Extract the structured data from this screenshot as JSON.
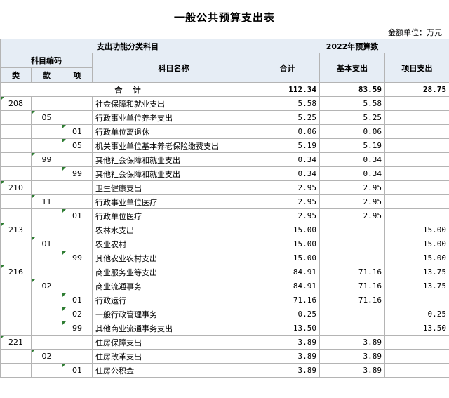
{
  "title": "一般公共预算支出表",
  "unit": "金额单位：万元",
  "headers": {
    "category_group": "支出功能分类科目",
    "budget_group": "2022年预算数",
    "code": "科目编码",
    "lei": "类",
    "kuan": "款",
    "xiang": "项",
    "name": "科目名称",
    "total": "合计",
    "basic": "基本支出",
    "project": "项目支出"
  },
  "total_row": {
    "label": "合    计",
    "total": "112.34",
    "basic": "83.59",
    "project": "28.75"
  },
  "rows": [
    {
      "lei": "208",
      "kuan": "",
      "xiang": "",
      "name": "社会保障和就业支出",
      "total": "5.58",
      "basic": "5.58",
      "project": ""
    },
    {
      "lei": "",
      "kuan": "05",
      "xiang": "",
      "name": "行政事业单位养老支出",
      "total": "5.25",
      "basic": "5.25",
      "project": ""
    },
    {
      "lei": "",
      "kuan": "",
      "xiang": "01",
      "name": "行政单位离退休",
      "total": "0.06",
      "basic": "0.06",
      "project": ""
    },
    {
      "lei": "",
      "kuan": "",
      "xiang": "05",
      "name": "机关事业单位基本养老保险缴费支出",
      "total": "5.19",
      "basic": "5.19",
      "project": ""
    },
    {
      "lei": "",
      "kuan": "99",
      "xiang": "",
      "name": "其他社会保障和就业支出",
      "total": "0.34",
      "basic": "0.34",
      "project": ""
    },
    {
      "lei": "",
      "kuan": "",
      "xiang": "99",
      "name": "其他社会保障和就业支出",
      "total": "0.34",
      "basic": "0.34",
      "project": ""
    },
    {
      "lei": "210",
      "kuan": "",
      "xiang": "",
      "name": "卫生健康支出",
      "total": "2.95",
      "basic": "2.95",
      "project": ""
    },
    {
      "lei": "",
      "kuan": "11",
      "xiang": "",
      "name": "行政事业单位医疗",
      "total": "2.95",
      "basic": "2.95",
      "project": ""
    },
    {
      "lei": "",
      "kuan": "",
      "xiang": "01",
      "name": "行政单位医疗",
      "total": "2.95",
      "basic": "2.95",
      "project": ""
    },
    {
      "lei": "213",
      "kuan": "",
      "xiang": "",
      "name": "农林水支出",
      "total": "15.00",
      "basic": "",
      "project": "15.00"
    },
    {
      "lei": "",
      "kuan": "01",
      "xiang": "",
      "name": "农业农村",
      "total": "15.00",
      "basic": "",
      "project": "15.00"
    },
    {
      "lei": "",
      "kuan": "",
      "xiang": "99",
      "name": "其他农业农村支出",
      "total": "15.00",
      "basic": "",
      "project": "15.00"
    },
    {
      "lei": "216",
      "kuan": "",
      "xiang": "",
      "name": "商业服务业等支出",
      "total": "84.91",
      "basic": "71.16",
      "project": "13.75"
    },
    {
      "lei": "",
      "kuan": "02",
      "xiang": "",
      "name": "商业流通事务",
      "total": "84.91",
      "basic": "71.16",
      "project": "13.75"
    },
    {
      "lei": "",
      "kuan": "",
      "xiang": "01",
      "name": "行政运行",
      "total": "71.16",
      "basic": "71.16",
      "project": ""
    },
    {
      "lei": "",
      "kuan": "",
      "xiang": "02",
      "name": "一般行政管理事务",
      "total": "0.25",
      "basic": "",
      "project": "0.25"
    },
    {
      "lei": "",
      "kuan": "",
      "xiang": "99",
      "name": "其他商业流通事务支出",
      "total": "13.50",
      "basic": "",
      "project": "13.50"
    },
    {
      "lei": "221",
      "kuan": "",
      "xiang": "",
      "name": "住房保障支出",
      "total": "3.89",
      "basic": "3.89",
      "project": ""
    },
    {
      "lei": "",
      "kuan": "02",
      "xiang": "",
      "name": "住房改革支出",
      "total": "3.89",
      "basic": "3.89",
      "project": ""
    },
    {
      "lei": "",
      "kuan": "",
      "xiang": "01",
      "name": "住房公积金",
      "total": "3.89",
      "basic": "3.89",
      "project": ""
    }
  ]
}
